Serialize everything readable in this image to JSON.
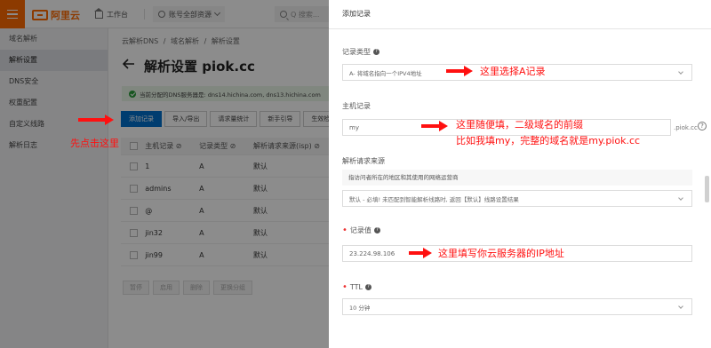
{
  "topbar": {
    "logo_text": "阿里云",
    "workbench": "工作台",
    "account": "账号全部资源",
    "search_placeholder": "Q 搜索..."
  },
  "sidebar": {
    "items": [
      {
        "label": "域名解析",
        "kind": "title"
      },
      {
        "label": "解析设置",
        "kind": "active"
      },
      {
        "label": "DNS安全",
        "kind": "item"
      },
      {
        "label": "权重配置",
        "kind": "item"
      },
      {
        "label": "自定义线路",
        "kind": "item"
      },
      {
        "label": "解析日志",
        "kind": "item"
      }
    ]
  },
  "main": {
    "breadcrumb": [
      "云解析DNS",
      "/",
      "域名解析",
      "/",
      "解析设置"
    ],
    "title": "解析设置 piok.cc",
    "notice": "当前分配的DNS服务器是: dns14.hichina.com, dns13.hichina.com",
    "toolbar": [
      "添加记录",
      "导入/导出",
      "请求量统计",
      "新手引导",
      "生效检测"
    ],
    "table": {
      "headers": [
        "主机记录 ⊘",
        "记录类型 ⊘",
        "解析请求来源(isp) ⊘"
      ],
      "rows": [
        {
          "host": "1",
          "type": "A",
          "line": "默认"
        },
        {
          "host": "admins",
          "type": "A",
          "line": "默认"
        },
        {
          "host": "@",
          "type": "A",
          "line": "默认"
        },
        {
          "host": "jin32",
          "type": "A",
          "line": "默认"
        },
        {
          "host": "jin99",
          "type": "A",
          "line": "默认"
        }
      ]
    },
    "bottom_buttons": [
      "暂停",
      "启用",
      "删除",
      "更换分组"
    ]
  },
  "panel": {
    "title": "添加记录",
    "record_type": {
      "label": "记录类型",
      "value": "A- 将域名指向一个IPV4地址"
    },
    "host": {
      "label": "主机记录",
      "value": "my",
      "suffix": ".piok.cc"
    },
    "line": {
      "label": "解析请求来源",
      "hint": "指访问者所在的地区和其使用的网络运营商",
      "value": "默认 - 必填! 未匹配到智能解析线路时, 返回【默认】线路设置结果"
    },
    "record_value": {
      "label": "记录值",
      "value": "23.224.98.106"
    },
    "ttl": {
      "label": "TTL",
      "value": "10 分钟"
    }
  },
  "annotations": {
    "click_add": "先点击这里",
    "select_a": "这里选择A记录",
    "host_line1": "这里随便填，二级域名的前缀",
    "host_line2": "比如我填my，完整的域名就是my.piok.cc",
    "ip": "这里填写你云服务器的IP地址"
  },
  "colors": {
    "brand": "#ff6a00",
    "primary": "#0070cc",
    "annotation": "#ff1010"
  }
}
